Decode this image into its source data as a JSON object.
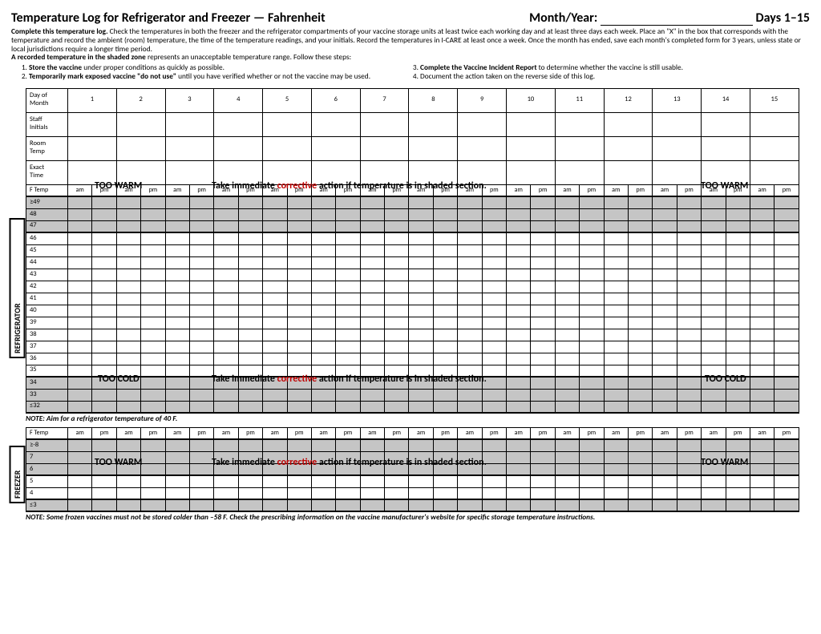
{
  "title_left": "Temperature Log for Refrigerator and Freezer — Fahrenheit",
  "title_month": "Month/Year:",
  "title_right": "Days 1–15",
  "instr_lead_b": "Complete this temperature log.",
  "instr_lead": "  Check the temperatures in both the freezer and the refrigerator compartments of your vaccine storage units at least twice each working day and at least three days each week. Place an \"X\" in the box that corresponds with the temperature and record the ambient (room) temperature, the time of the temperature readings, and your initials. Record the temperatures in I-CARE at least once a week.  Once the month has ended, save each month's completed form for 3 years, unless state or local jurisdictions require a longer time period.",
  "instr2_b": "A recorded temperature in the shaded zone",
  "instr2": " represents an unacceptable temperature range. Follow these steps:",
  "step1a": "Store the vaccine",
  "step1b": " under proper conditions as quickly as possible.",
  "step2a": "Temporarily mark exposed vaccine \"do not use\"",
  "step2b": " until you have verified whether or not the vaccine may be used.",
  "step3a": "Complete the Vaccine Incident Report",
  "step3b": " to determine whether the vaccine is still usable.",
  "step4": "Document the action taken on the reverse side of this log.",
  "rows_header": [
    "Day of Month",
    "Staff Initials",
    "Room Temp",
    "Exact Time",
    "F Temp"
  ],
  "days": [
    "1",
    "2",
    "3",
    "4",
    "5",
    "6",
    "7",
    "8",
    "9",
    "10",
    "11",
    "12",
    "13",
    "14",
    "15"
  ],
  "ampm": [
    "am",
    "pm"
  ],
  "refrig_label": "REFRIGERATOR",
  "freezer_label": "FREEZER",
  "refrig_warm_rows": [
    "≥49",
    "48",
    "47"
  ],
  "refrig_mid_rows": [
    "46",
    "45",
    "44",
    "43",
    "42",
    "41",
    "40",
    "39",
    "38",
    "37",
    "36",
    "35"
  ],
  "refrig_cold_rows": [
    "34",
    "33",
    "≤32"
  ],
  "freezer_warm_rows": [
    "≥-8",
    "7",
    "6"
  ],
  "freezer_mid_rows": [
    "5",
    "4"
  ],
  "freezer_cold_rows": [
    "≤3"
  ],
  "too_warm": "TOO WARM",
  "too_cold": "TOO COLD",
  "msg_a": "Take immediate ",
  "msg_b": "corrective",
  "msg_c": " action if temperature is in shaded section.",
  "note1": "NOTE:  Aim for a refrigerator temperature of 40 F.",
  "note2": "NOTE:  Some frozen vaccines must not be stored colder than –58 F.  Check the prescribing information on the vaccine manufacturer's website for specific storage temperature instructions.",
  "ftemp": "F Temp"
}
